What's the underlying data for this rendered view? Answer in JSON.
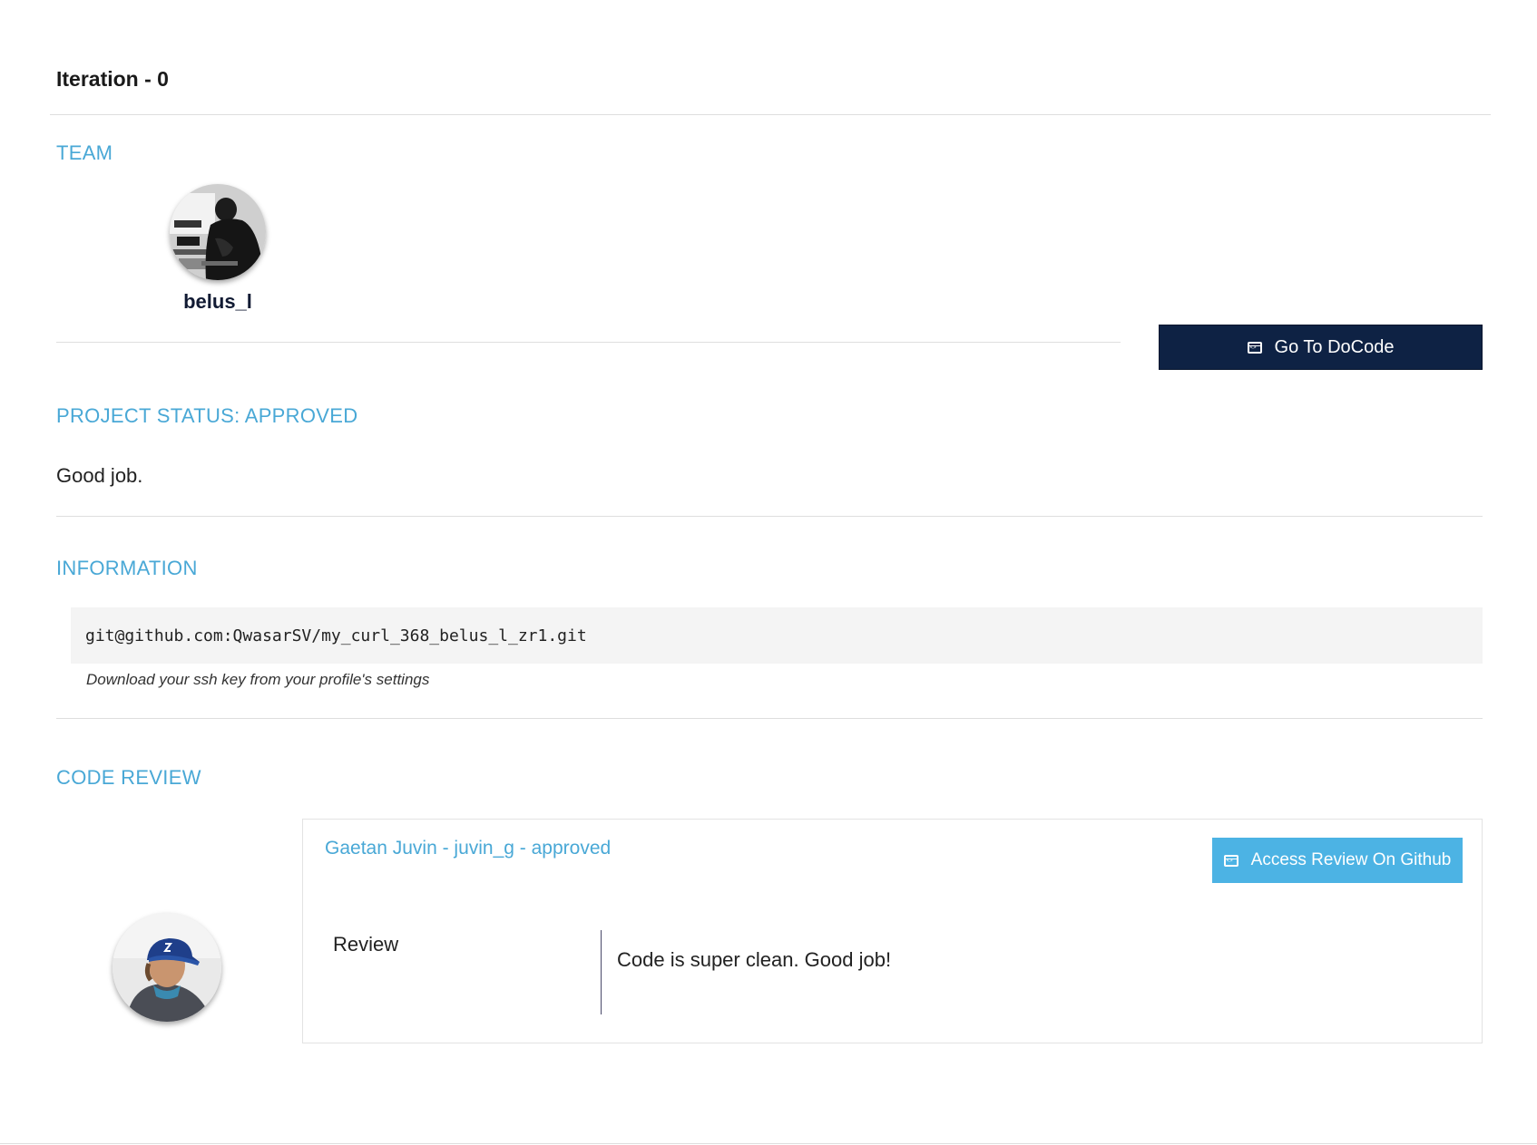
{
  "iteration": {
    "title": "Iteration - 0"
  },
  "team": {
    "heading": "TEAM",
    "members": [
      {
        "username": "belus_l"
      }
    ]
  },
  "actions": {
    "docode_label": "Go To DoCode"
  },
  "project_status": {
    "heading": "PROJECT STATUS: APPROVED",
    "comment": "Good job."
  },
  "information": {
    "heading": "INFORMATION",
    "repo_url": "git@github.com:QwasarSV/my_curl_368_belus_l_zr1.git",
    "ssh_hint": "Download your ssh key from your profile's settings"
  },
  "code_review": {
    "heading": "CODE REVIEW",
    "reviewer_line": "Gaetan Juvin - juvin_g - approved",
    "github_button_label": "Access Review On Github",
    "review_label": "Review",
    "review_text": "Code is super clean. Good job!"
  },
  "colors": {
    "accent": "#49a8d6",
    "primary_button": "#0e2244",
    "secondary_button": "#4cb3e4"
  },
  "icons": {
    "docode_button": "code-window-icon",
    "github_button": "code-window-icon"
  }
}
